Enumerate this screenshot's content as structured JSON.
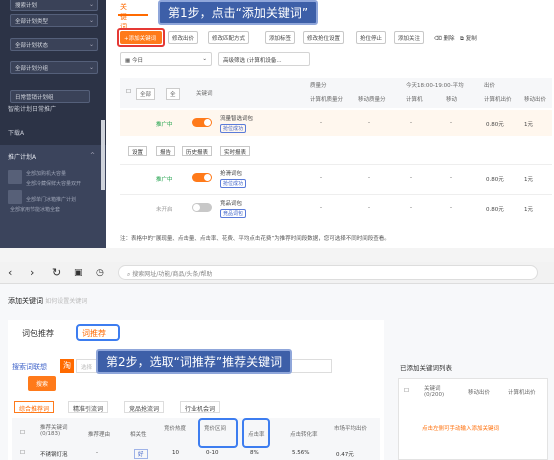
{
  "sidebar": {
    "selects": [
      "搜索计划",
      "全部计划类型",
      "全部计划状态",
      "全部计划分组",
      "日常营销计划组"
    ],
    "items": [
      "智能计划日常推广",
      "下载A",
      "推广计划A"
    ],
    "blurred_lines": [
      "全部加购机大容量",
      "全部冷藏保鲜大容量双开",
      "全部单门冰箱推广计划",
      "全部家用节能冰箱全套"
    ]
  },
  "main": {
    "tab_keyword": "关键词",
    "callout_step1": "第1步，点击“添加关键词”",
    "buttons": [
      "+添加关键词",
      "修改出价",
      "修改匹配方式",
      "添加标签",
      "修改抢位设置",
      "抢位停止",
      "添加关注",
      "删除",
      "复制"
    ],
    "filter_today": "今日",
    "filter_search": "高级筛选  (计算机设备...",
    "headers": {
      "all": "全部",
      "all2": "全",
      "keyword": "关键词",
      "quality": "质量分",
      "pc_quality": "计算机质量分",
      "mobile_quality": "移动质量分",
      "rank_head": "今天18:00-19:00-平均",
      "pc_rank": "计算机",
      "mobile_rank": "移动",
      "bid_head": "出价",
      "pc_bid": "计算机出价",
      "mobile_bid": "移动出价"
    },
    "rows": [
      {
        "status": "推广中",
        "keyword": "流量智选词包",
        "badge": "抢位成功",
        "dash": "-",
        "pc_bid": "0.80元",
        "mobile_bid": "1元"
      },
      {
        "status": "推广中",
        "keyword": "抢滑词包",
        "badge": "抢位成功",
        "dash": "-",
        "pc_bid": "0.80元",
        "mobile_bid": "1元"
      },
      {
        "status": "未开启",
        "keyword": "竞品词包",
        "badge": "竞品词包",
        "dash": "-",
        "pc_bid": "0.80元",
        "mobile_bid": "1元"
      }
    ],
    "sub_buttons": [
      "设置",
      "报告",
      "历史报表",
      "实时报表"
    ],
    "note": "注：表格中的“展现量、点击量、点击率、花费、平均点击花费”为推荐时间段数据，您可选择不同时间段查看。"
  },
  "browser": {
    "url_placeholder": "搜索网址/功能/商品/头条/帮助"
  },
  "bottom": {
    "title": "添加关键词",
    "subtitle": "如何设置关键词",
    "seg_bundle": "词包推荐",
    "seg_recommend": "词推荐",
    "callout_step2": "第2步，选取“词推荐”推荐关键词",
    "search_label": "搜索词联想",
    "search_badge": "淘",
    "search_placeholder": "选择",
    "search_button": "搜索",
    "filter_tabs": [
      "综合推荐词",
      "精准引流词",
      "竞品抢流词",
      "行业机会词"
    ],
    "col_headers": [
      "推荐关键词(0/183)",
      "推荐理由",
      "相关性",
      "竞价热度",
      "竞价区间",
      "点击率",
      "点击转化率",
      "市场平均出价"
    ],
    "row": {
      "keyword": "不锈钢灯泡",
      "reason": "-",
      "relevance": "好",
      "hot": "10",
      "range": "0-10",
      "ctr": "8%",
      "cvr": "5.56%",
      "avg_bid": "0.47元"
    },
    "selected_title": "已添加关键词列表",
    "selected_col1": "关键词(0/200)",
    "selected_col2": "移动出价",
    "selected_col3": "计算机出价",
    "selected_empty": "点击左侧可手动输入添加关键词"
  },
  "colors": {
    "accent": "#ff7a1a",
    "callout": "#3d5fa8",
    "sidebar": "#2c3346",
    "highlight_blue": "#3d7df0",
    "highlight_red": "#e53935"
  }
}
